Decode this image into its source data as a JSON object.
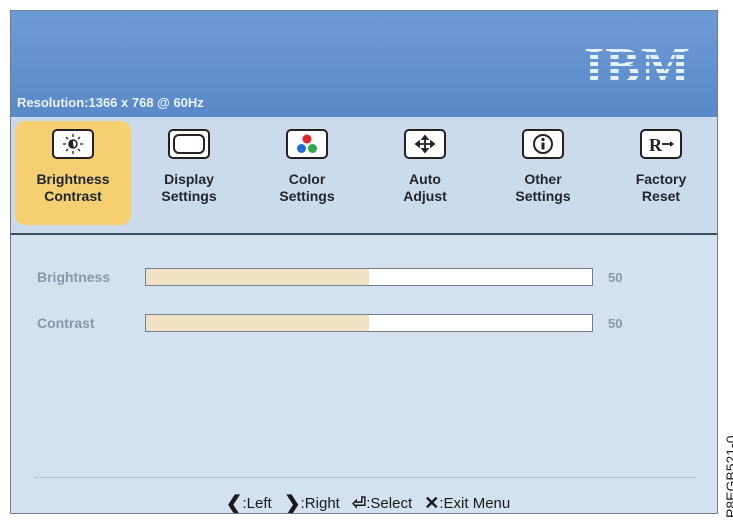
{
  "header": {
    "logo": "IBM",
    "resolution": "Resolution:1366 x 768 @ 60Hz"
  },
  "tabs": [
    {
      "line1": "Brightness",
      "line2": "Contrast",
      "icon": "brightness-icon",
      "active": true
    },
    {
      "line1": "Display",
      "line2": "Settings",
      "icon": "display-icon",
      "active": false
    },
    {
      "line1": "Color",
      "line2": "Settings",
      "icon": "color-icon",
      "active": false
    },
    {
      "line1": "Auto",
      "line2": "Adjust",
      "icon": "auto-adjust-icon",
      "active": false
    },
    {
      "line1": "Other",
      "line2": "Settings",
      "icon": "info-icon",
      "active": false
    },
    {
      "line1": "Factory",
      "line2": "Reset",
      "icon": "factory-reset-icon",
      "active": false
    }
  ],
  "settings": [
    {
      "label": "Brightness",
      "value": "50",
      "level": 0.5
    },
    {
      "label": "Contrast",
      "value": "50",
      "level": 0.5
    }
  ],
  "footer": {
    "left": ":Left",
    "right": ":Right",
    "select": ":Select",
    "exit": ":Exit Menu"
  },
  "side_code": "P8EGB521-0",
  "colors": {
    "header": "#5a89c8",
    "tab_bar": "#cbdbec",
    "active_tab": "#f5cf72",
    "content": "#d4e2ef",
    "slider_fill": "#f0e1c5"
  }
}
